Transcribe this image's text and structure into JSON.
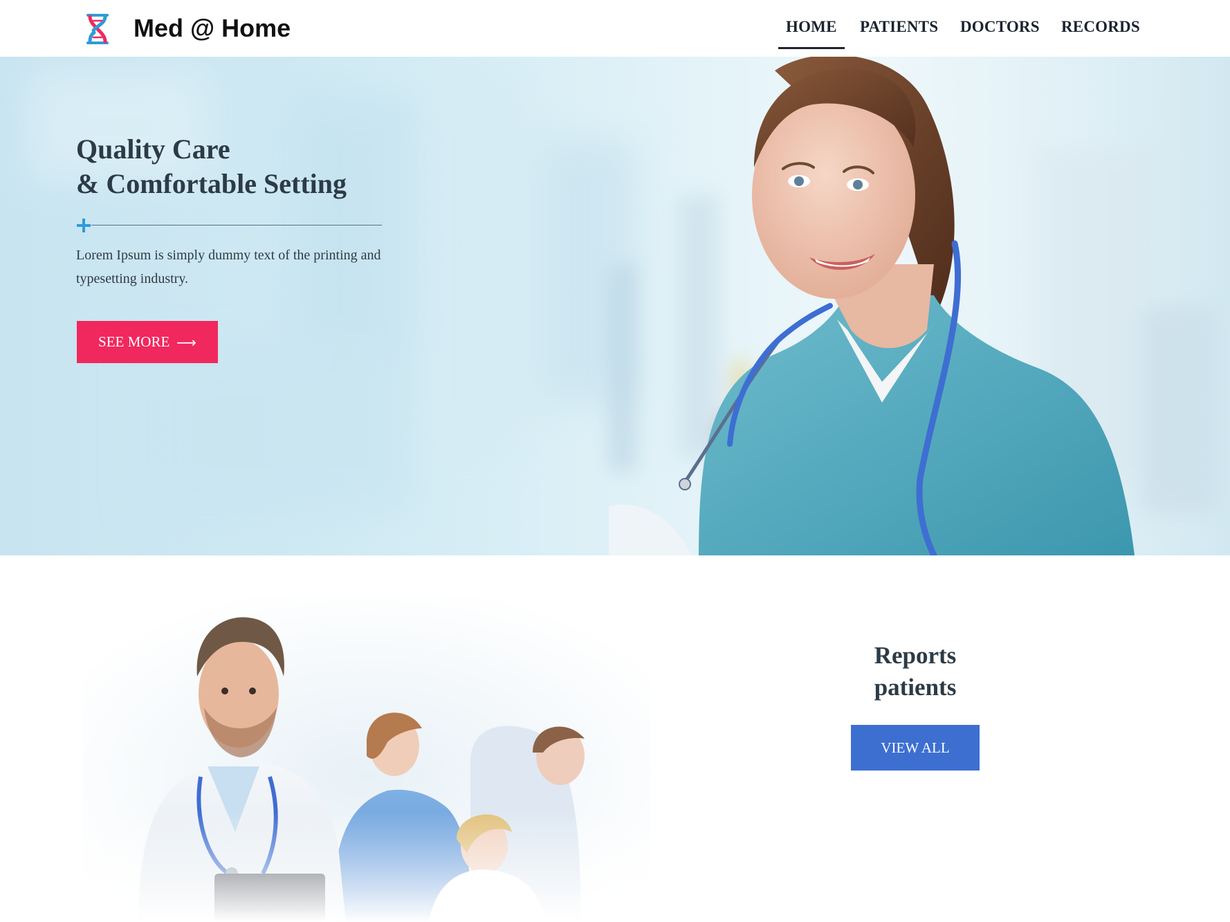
{
  "brand": {
    "name": "Med @ Home",
    "logo_icon": "dna-helix-icon",
    "logo_colors": [
      "#f0285e",
      "#2f9bd8"
    ]
  },
  "nav": {
    "items": [
      {
        "label": "HOME",
        "active": true
      },
      {
        "label": "PATIENTS",
        "active": false
      },
      {
        "label": "DOCTORS",
        "active": false
      },
      {
        "label": "RECORDS",
        "active": false
      }
    ]
  },
  "hero": {
    "title_line1": "Quality Care",
    "title_line2": "& Comfortable Setting",
    "divider_icon": "plus-icon",
    "description": "Lorem Ipsum is simply dummy text of the printing and typesetting industry.",
    "cta_label": "SEE MORE",
    "cta_icon": "arrow-right-icon",
    "cta_color": "#f0285e",
    "image": "nurse-with-stethoscope"
  },
  "reports": {
    "title_line1": "Reports",
    "title_line2": "patients",
    "button_label": "VIEW ALL",
    "button_color": "#3d6fd0",
    "image": "doctor-and-patients"
  }
}
